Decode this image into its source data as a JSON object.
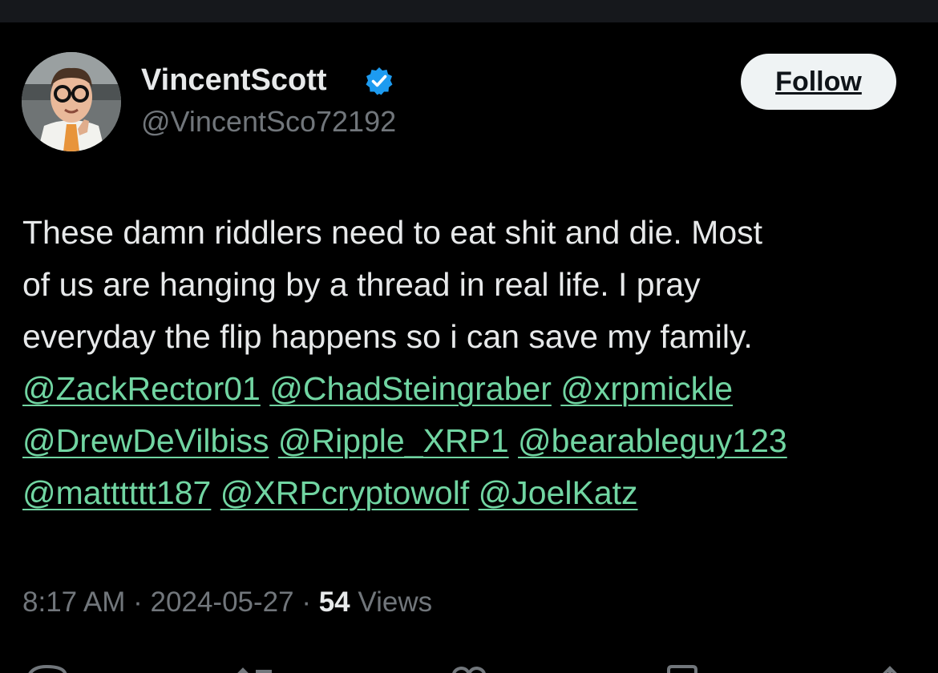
{
  "colors": {
    "background": "#000000",
    "text": "#e7e9ea",
    "secondary_text": "#71767b",
    "mention": "#71d5a2",
    "verified": "#1d9bf0",
    "follow_button_bg": "#eff3f4"
  },
  "user": {
    "display_name": "VincentScott",
    "handle": "@VincentSco72192",
    "verified_icon": "verified-badge-icon"
  },
  "follow_button": {
    "label": "Follow"
  },
  "tweet": {
    "lines": [
      "These damn riddlers need to eat shit and die. Most",
      "of us are hanging by a thread in real life. I pray",
      "everyday the flip happens so i can save my family."
    ],
    "mentions": [
      "@ZackRector01",
      "@ChadSteingraber",
      "@xrpmickle",
      "@DrewDeVilbiss",
      "@Ripple_XRP1",
      "@bearableguy123",
      "@matttttt187",
      "@XRPcryptowolf",
      "@JoelKatz"
    ]
  },
  "meta": {
    "time": "8:17 AM",
    "separator": "·",
    "date": "2024-05-27",
    "views_count": "54",
    "views_label": "Views"
  },
  "actions": [
    {
      "icon": "reply-icon"
    },
    {
      "icon": "retweet-icon"
    },
    {
      "icon": "like-icon"
    },
    {
      "icon": "bookmark-icon"
    },
    {
      "icon": "share-icon"
    }
  ]
}
